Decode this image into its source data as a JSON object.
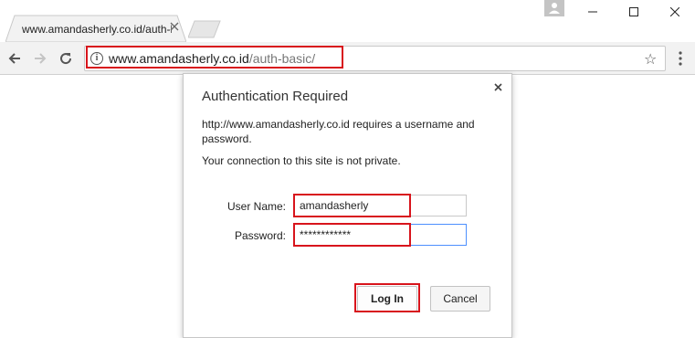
{
  "browser": {
    "tab_title": "www.amandasherly.co.id/auth-basic/",
    "url_host": "www.amandasherly.co.id",
    "url_path": "/auth-basic/"
  },
  "dialog": {
    "title": "Authentication Required",
    "message": "http://www.amandasherly.co.id requires a username and password.",
    "privacy_note": "Your connection to this site is not private.",
    "username_label": "User Name:",
    "username_value": "amandasherly",
    "password_label": "Password:",
    "password_value": "************",
    "login_label": "Log In",
    "cancel_label": "Cancel"
  },
  "icons": {
    "back": "back-arrow-icon",
    "forward": "forward-arrow-icon",
    "reload": "reload-icon",
    "info": "info-icon",
    "star": "star-icon",
    "menu": "kebab-menu-icon",
    "close": "close-icon"
  },
  "colors": {
    "highlight": "#d8141c",
    "focus": "#4d90fe"
  }
}
